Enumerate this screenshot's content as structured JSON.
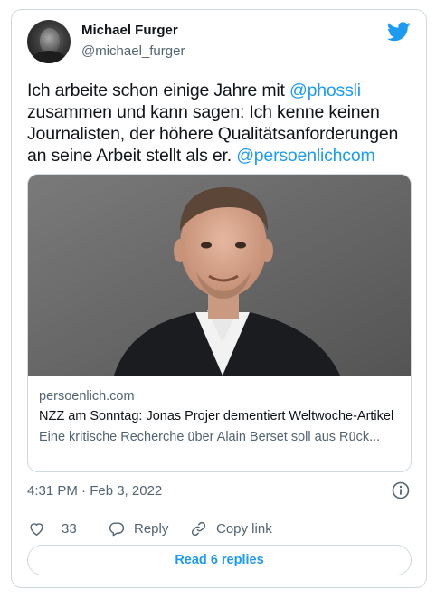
{
  "tweet": {
    "author": {
      "name": "Michael Furger",
      "handle": "@michael_furger"
    },
    "text": {
      "part1": "Ich arbeite schon einige Jahre mit ",
      "mention1": "@phossli",
      "part2": " zusammen und kann sagen: Ich kenne keinen Journalisten, der höhere Qualitätsanforderungen an seine Arbeit stellt als er. ",
      "mention2": "@persoenlichcom"
    },
    "link_card": {
      "domain": "persoenlich.com",
      "title": "NZZ am Sonntag: Jonas Projer dementiert Weltwoche-Artikel",
      "description": "Eine kritische Recherche über Alain Berset soll aus Rück..."
    },
    "timestamp": "4:31 PM · Feb 3, 2022",
    "actions": {
      "like_count": "33",
      "reply_label": "Reply",
      "copy_label": "Copy link"
    },
    "read_replies_label": "Read 6 replies"
  },
  "icons": {
    "brand": "twitter-bird-icon",
    "info": "info-icon",
    "like": "heart-icon",
    "reply": "speech-bubble-icon",
    "copy": "link-icon"
  },
  "colors": {
    "accent": "#1d9bf0",
    "text": "#0f1419",
    "secondary": "#536471",
    "border": "#cfd9de"
  }
}
